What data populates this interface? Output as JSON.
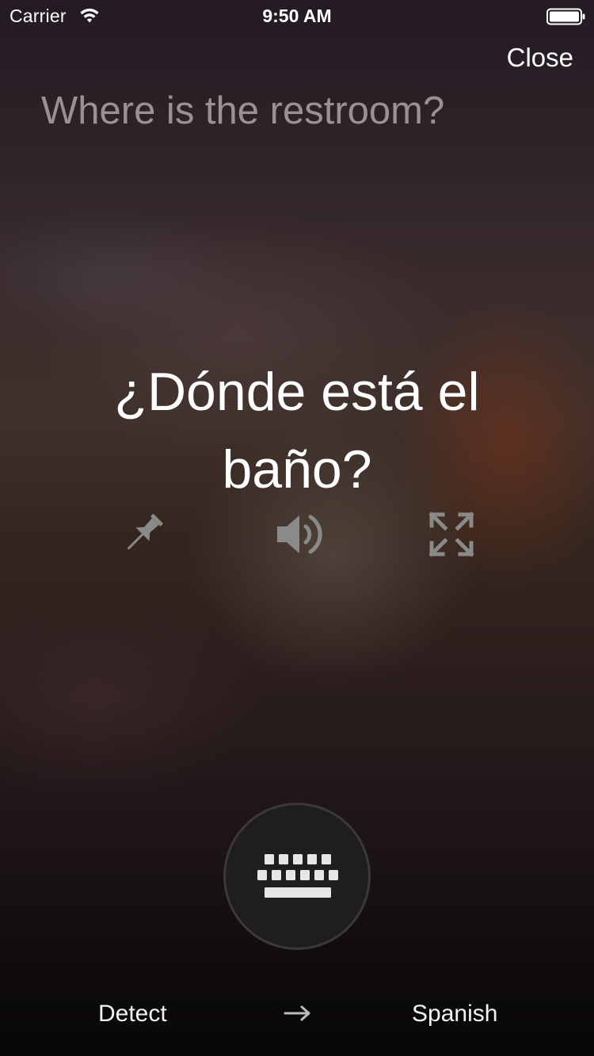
{
  "status_bar": {
    "carrier": "Carrier",
    "time": "9:50 AM",
    "wifi_icon": "wifi-icon",
    "battery_icon": "battery-icon"
  },
  "header": {
    "close_label": "Close"
  },
  "source": {
    "text": "Where is the restroom?"
  },
  "translation": {
    "text": "¿Dónde está el baño?"
  },
  "actions": [
    {
      "icon": "pin-icon",
      "name": "pin"
    },
    {
      "icon": "speaker-icon",
      "name": "speak"
    },
    {
      "icon": "expand-icon",
      "name": "fullscreen"
    }
  ],
  "input": {
    "icon": "keyboard-icon"
  },
  "languages": {
    "source": "Detect",
    "arrow": "→",
    "target": "Spanish"
  },
  "colors": {
    "text_primary": "#ffffff",
    "text_dim": "#dcd7da",
    "icon_gray": "#8a8a8a",
    "button_bg": "#1f1d1f"
  }
}
